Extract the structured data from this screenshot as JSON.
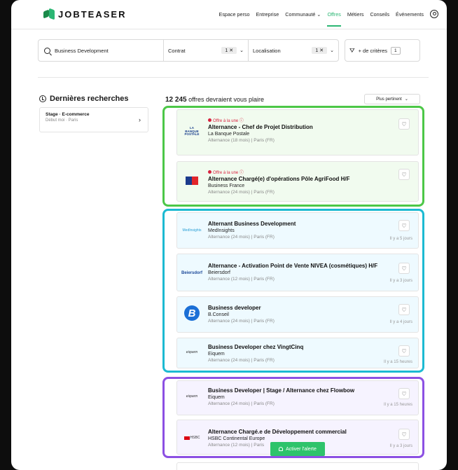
{
  "header": {
    "brand": "JOBTEASER",
    "nav": [
      "Espace perso",
      "Entreprise",
      "Communauté",
      "Offres",
      "Métiers",
      "Conseils",
      "Événements"
    ],
    "active_nav": "Offres",
    "accent": "#2bb673"
  },
  "search": {
    "query": "Business Development",
    "contrat_label": "Contrat",
    "contrat_count": "1 ✕",
    "loc_label": "Localisation",
    "loc_count": "1 ✕",
    "more_label": "+ de critères",
    "more_count": "1"
  },
  "sidebar": {
    "title": "Dernières recherches",
    "recent": {
      "title": "Stage · E-commerce",
      "subtitle": "Début moi · Paris"
    }
  },
  "results": {
    "count": "12 245",
    "count_suffix": "offres devraient vous plaire",
    "sort_label": "Plus pertinent"
  },
  "jobs": [
    {
      "featured": "Offre à la une ⓘ",
      "title": "Alternance - Chef de Projet Distribution",
      "company": "La Banque Postale",
      "meta": "Alternance (18 mois) | Paris (FR)",
      "date": "",
      "logo": "LA BANQUE POSTALE"
    },
    {
      "featured": "Offre à la une ⓘ",
      "title": "Alternance Chargé(e) d'opérations Pôle AgriFood H/F",
      "company": "Business France",
      "meta": "Alternance (24 mois) | Paris (FR)",
      "date": "",
      "logo": ""
    },
    {
      "featured": "",
      "title": "Alternant Business Development",
      "company": "MedInsights",
      "meta": "Alternance (24 mois) | Paris (FR)",
      "date": "Il y a 5 jours",
      "logo": "MedInsights"
    },
    {
      "featured": "",
      "title": "Alternance - Activation Point de Vente NIVEA (cosmétiques) H/F",
      "company": "Beiersdorf",
      "meta": "Alternance (12 mois) | Paris (FR)",
      "date": "Il y a 3 jours",
      "logo": "Beiersdorf"
    },
    {
      "featured": "",
      "title": "Business developer",
      "company": "B.Conseil",
      "meta": "Alternance (24 mois) | Paris (FR)",
      "date": "Il y a 4 jours",
      "logo": "B"
    },
    {
      "featured": "",
      "title": "Business Developer chez VingtCinq",
      "company": "Eiquem",
      "meta": "Alternance (24 mois) | Paris (FR)",
      "date": "Il y a 15 heures",
      "logo": "eiquem"
    },
    {
      "featured": "",
      "title": "Business Developer | Stage / Alternance chez Flowbow",
      "company": "Eiquem",
      "meta": "Alternance (24 mois) | Paris (FR)",
      "date": "Il y a 15 heures",
      "logo": "eiquem"
    },
    {
      "featured": "",
      "title": "Alternance Chargé.e de Développement commercial",
      "company": "HSBC  Continental Europe",
      "meta": "Alternance (12 mois) | Paris",
      "date": "Il y a 3 jours",
      "logo": "HSBC"
    }
  ],
  "alert_button": "Activer l'alerte",
  "colors": {
    "green_group": "#4cc747",
    "cyan_group": "#1cbad2",
    "purple_group": "#8c50e3",
    "featured": "#d8233f"
  }
}
